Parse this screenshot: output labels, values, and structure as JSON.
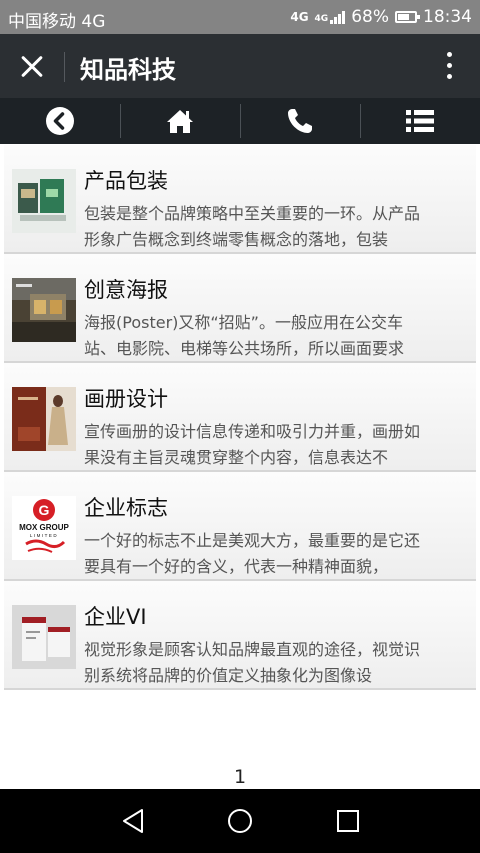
{
  "status_bar": {
    "carrier": "中国移动 4G",
    "network_left": "4G",
    "network_right": "4G",
    "battery": "68%",
    "battery_level": 0.68,
    "time": "18:34"
  },
  "title_bar": {
    "title": "知品科技"
  },
  "nav": {
    "icons": [
      "back-circle-icon",
      "home-icon",
      "phone-icon",
      "menu-list-icon"
    ]
  },
  "items": [
    {
      "title": "产品包装",
      "desc": "包装是整个品牌策略中至关重要的一环。从产品形象广告概念到终端零售概念的落地，包装"
    },
    {
      "title": "创意海报",
      "desc": "海报(Poster)又称“招贴”。一般应用在公交车站、电影院、电梯等公共场所，所以画面要求"
    },
    {
      "title": "画册设计",
      "desc": "宣传画册的设计信息传递和吸引力并重，画册如果没有主旨灵魂贯穿整个内容，信息表达不"
    },
    {
      "title": "企业标志",
      "desc": "一个好的标志不止是美观大方，最重要的是它还要具有一个好的含义，代表一种精神面貌，"
    },
    {
      "title": "企业VI",
      "desc": "视觉形象是顾客认知品牌最直观的途径，视觉识别系统将品牌的价值定义抽象化为图像设"
    }
  ],
  "logo_text": {
    "line1": "MOX GROUP",
    "line2": "LIMITED"
  },
  "pagination": {
    "page": "1"
  },
  "colors": {
    "status_bar": "#848484",
    "title_bar": "#2b2f33",
    "nav_bar": "#1d2226",
    "system_bar": "#000000"
  }
}
